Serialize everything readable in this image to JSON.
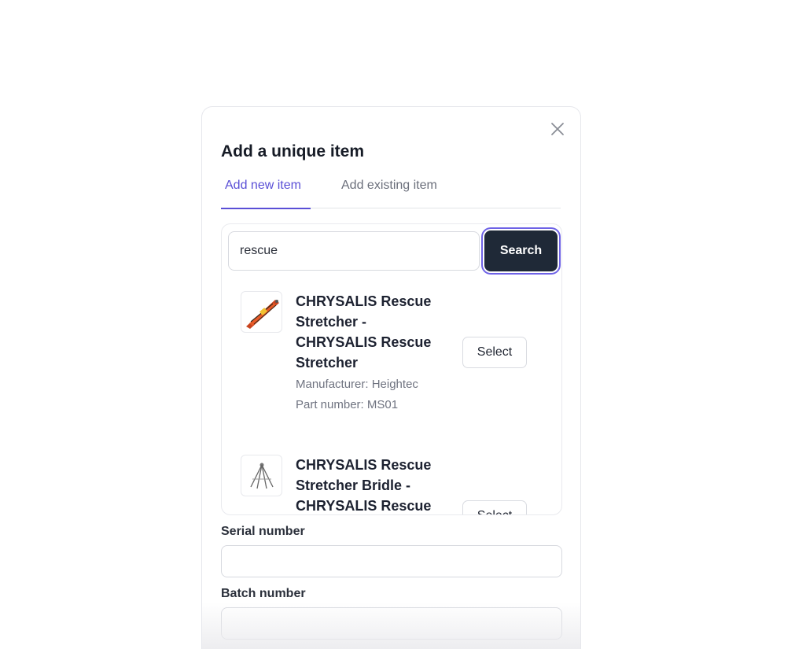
{
  "modal": {
    "title": "Add a unique item",
    "close_icon": "close-icon"
  },
  "tabs": [
    {
      "label": "Add new item",
      "active": true
    },
    {
      "label": "Add existing item",
      "active": false
    }
  ],
  "search": {
    "value": "rescue",
    "button_label": "Search"
  },
  "results": [
    {
      "name": "CHRYSALIS Rescue Stretcher - CHRYSALIS Rescue Stretcher",
      "manufacturer": "Manufacturer: Heightec",
      "part_number": "Part number: MS01",
      "select_label": "Select",
      "thumbnail_icon": "stretcher-image"
    },
    {
      "name": "CHRYSALIS Rescue Stretcher Bridle - CHRYSALIS Rescue",
      "select_label": "Select",
      "thumbnail_icon": "bridle-image"
    }
  ],
  "fields": {
    "serial_number": {
      "label": "Serial number",
      "value": ""
    },
    "batch_number": {
      "label": "Batch number",
      "value": ""
    }
  },
  "colors": {
    "accent": "#5a4fd6",
    "primary_button": "#1f2937",
    "focus_ring": "#6e62e6"
  }
}
